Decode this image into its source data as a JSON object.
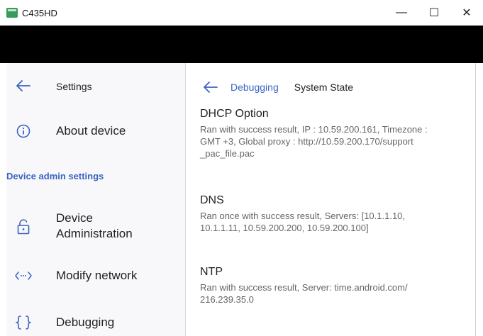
{
  "window": {
    "title": "C435HD",
    "minimize_glyph": "—",
    "maximize_glyph": "☐",
    "close_glyph": "✕"
  },
  "sidebar": {
    "back_label": "Settings",
    "items": [
      {
        "label": "About device",
        "icon": "info-icon"
      },
      {
        "label": "Device\nAdministration",
        "icon": "lock-open-icon"
      },
      {
        "label": "Modify network",
        "icon": "code-arrows-icon"
      },
      {
        "label": "Debugging",
        "icon": "braces-icon"
      }
    ],
    "section_header": "Device admin settings"
  },
  "main": {
    "breadcrumb": {
      "parent": "Debugging",
      "current": "System State"
    },
    "entries": [
      {
        "title": "DHCP Option",
        "desc": "Ran with success result, IP : 10.59.200.161, Timezone :\nGMT +3, Global proxy : http://10.59.200.170/support\n_pac_file.pac"
      },
      {
        "title": "DNS",
        "desc": "Ran once with success result, Servers: [10.1.1.10,\n10.1.1.11, 10.59.200.200, 10.59.200.100]"
      },
      {
        "title": "NTP",
        "desc": "Ran with success result, Server: time.android.com/\n216.239.35.0"
      }
    ]
  },
  "colors": {
    "accent": "#3b62c4",
    "app_icon": "#3a9a5c"
  }
}
